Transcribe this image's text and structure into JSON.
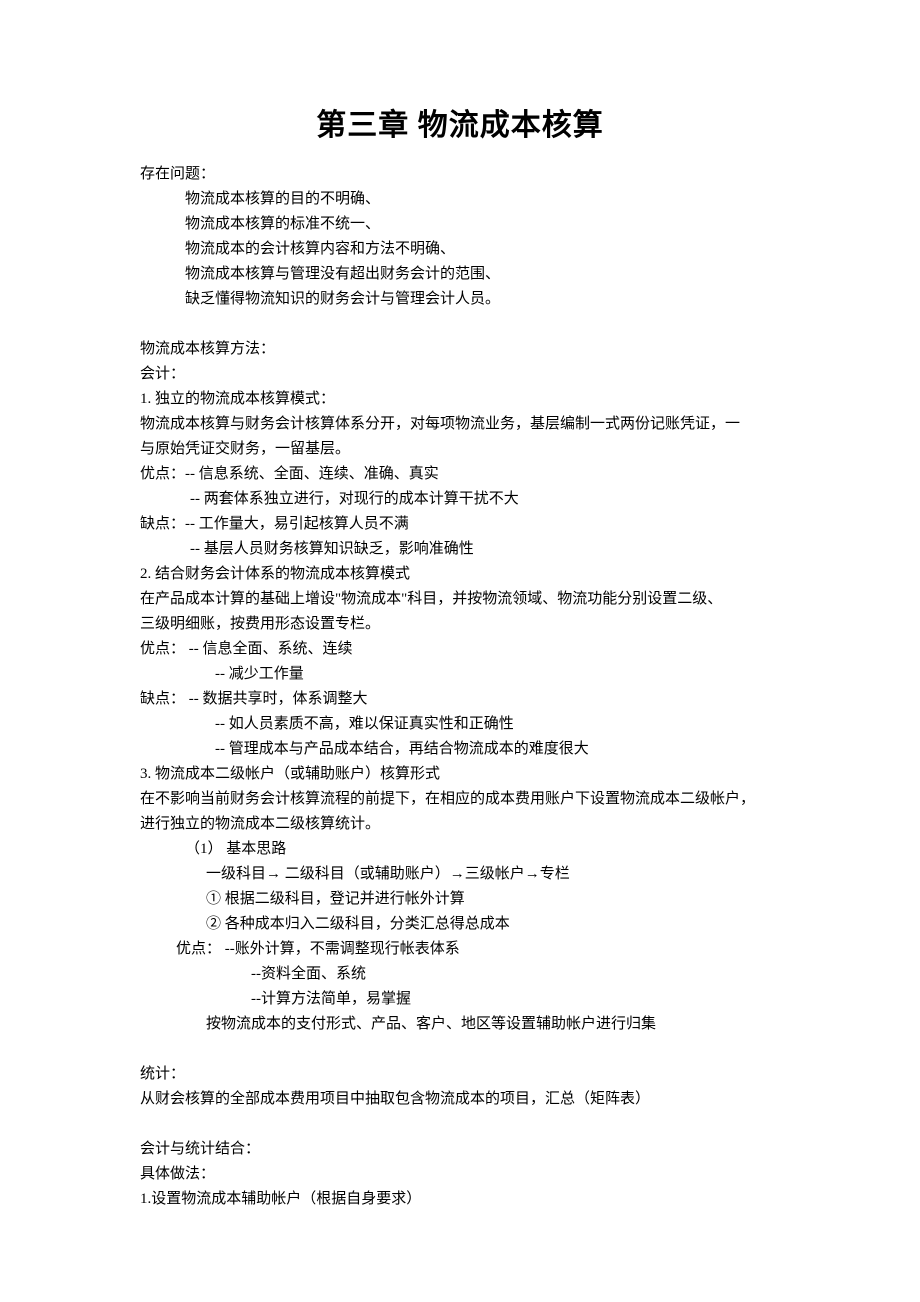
{
  "title": "第三章  物流成本核算",
  "problems": {
    "heading": "存在问题：",
    "items": [
      "物流成本核算的目的不明确、",
      "物流成本核算的标准不统一、",
      "物流成本的会计核算内容和方法不明确、",
      "物流成本核算与管理没有超出财务会计的范围、",
      "缺乏懂得物流知识的财务会计与管理会计人员。"
    ]
  },
  "methods": {
    "heading": "物流成本核算方法："
  },
  "accounting": {
    "heading": "会计："
  },
  "m1": {
    "title": "1. 独立的物流成本核算模式：",
    "desc1": "物流成本核算与财务会计核算体系分开，对每项物流业务，基层编制一式两份记账凭证，一",
    "desc2": "与原始凭证交财务，一留基层。",
    "adv_label": "优点：-- 信息系统、全面、连续、准确、真实",
    "adv2": "-- 两套体系独立进行，对现行的成本计算干扰不大",
    "dis_label": "缺点：-- 工作量大，易引起核算人员不满",
    "dis2": "-- 基层人员财务核算知识缺乏，影响准确性"
  },
  "m2": {
    "title": "2. 结合财务会计体系的物流成本核算模式",
    "desc1": "在产品成本计算的基础上增设\"物流成本\"科目，并按物流领域、物流功能分别设置二级、",
    "desc2": "三级明细账，按费用形态设置专栏。",
    "adv_label": "优点：    --  信息全面、系统、连续",
    "adv2": "--  减少工作量",
    "dis_label": "缺点：    --  数据共享时，体系调整大",
    "dis2": "--  如人员素质不高，难以保证真实性和正确性",
    "dis3": "--  管理成本与产品成本结合，再结合物流成本的难度很大"
  },
  "m3": {
    "title": "3. 物流成本二级帐户（或辅助账户）核算形式",
    "desc1": "在不影响当前财务会计核算流程的前提下，在相应的成本费用账户下设置物流成本二级帐户，",
    "desc2": "进行独立的物流成本二级核算统计。",
    "s1": "（1）  基本思路",
    "s2": "一级科目→  二级科目（或辅助账户）→三级帐户→专栏",
    "s3": "①  根据二级科目，登记并进行帐外计算",
    "s4": "②  各种成本归入二级科目，分类汇总得总成本",
    "adv_label": "优点：    --账外计算，不需调整现行帐表体系",
    "adv2": "--资料全面、系统",
    "adv3": "--计算方法简单，易掌握",
    "note": "按物流成本的支付形式、产品、客户、地区等设置辅助帐户进行归集"
  },
  "stats": {
    "heading": "统计：",
    "desc": "从财会核算的全部成本费用项目中抽取包含物流成本的项目，汇总（矩阵表）"
  },
  "combo": {
    "heading": "会计与统计结合：",
    "sub": "具体做法：",
    "i1": "1.设置物流成本辅助帐户（根据自身要求）"
  }
}
